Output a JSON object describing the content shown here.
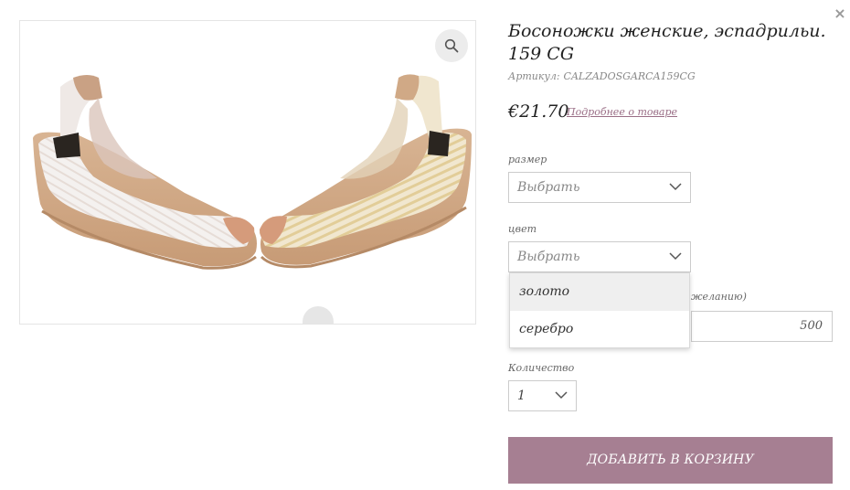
{
  "modal": {
    "close_icon": "close-icon",
    "close_glyph": "×"
  },
  "product": {
    "title": "Босоножки женские, эспадрильи. 159 CG",
    "sku_label": "Артикул:",
    "sku_value": "CALZADOSGARCA159CG",
    "price": "€21.70",
    "more_link": "Подробнее о товаре",
    "image_alt": "espadrille wedge sandals"
  },
  "size": {
    "label": "размер",
    "value": "Выбрать"
  },
  "color": {
    "label": "цвет",
    "value": "Выбрать",
    "options": [
      "золото",
      "серебро"
    ]
  },
  "amount": {
    "label_partial": "желанию)",
    "value": "500"
  },
  "quantity": {
    "label": "Количество",
    "value": "1"
  },
  "cart": {
    "add_label": "ДОБАВИТЬ В КОРЗИНУ",
    "color": "#a67f92"
  }
}
